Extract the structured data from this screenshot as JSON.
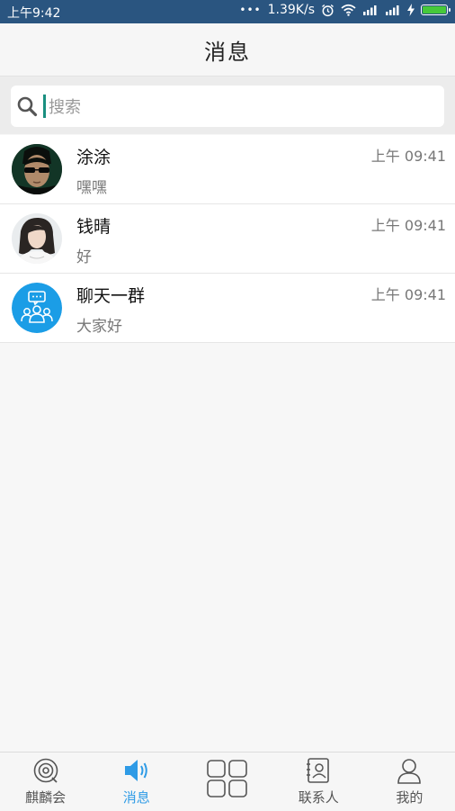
{
  "status_bar": {
    "time": "上午9:42",
    "dots": "•••",
    "network_speed": "1.39K/s",
    "battery_percent": 100,
    "battery_color": "#46c93a"
  },
  "header": {
    "title": "消息"
  },
  "search": {
    "placeholder": "搜索",
    "value": ""
  },
  "conversations": [
    {
      "name": "涂涂",
      "message": "嘿嘿",
      "time": "上午 09:41",
      "avatar": "portrait-matrix"
    },
    {
      "name": "钱晴",
      "message": "好",
      "time": "上午 09:41",
      "avatar": "portrait-girl"
    },
    {
      "name": "聊天一群",
      "message": "大家好",
      "time": "上午 09:41",
      "avatar": "group-chat-icon"
    }
  ],
  "tabs": [
    {
      "label": "麒麟会",
      "icon": "qilin-icon",
      "active": false
    },
    {
      "label": "消息",
      "icon": "speaker-icon",
      "active": true
    },
    {
      "label": "",
      "icon": "grid-icon",
      "active": false
    },
    {
      "label": "联系人",
      "icon": "contacts-icon",
      "active": false
    },
    {
      "label": "我的",
      "icon": "profile-icon",
      "active": false
    }
  ],
  "colors": {
    "accent": "#2e9be6",
    "status_bar": "#2a5580",
    "group_avatar": "#1b9de6"
  }
}
